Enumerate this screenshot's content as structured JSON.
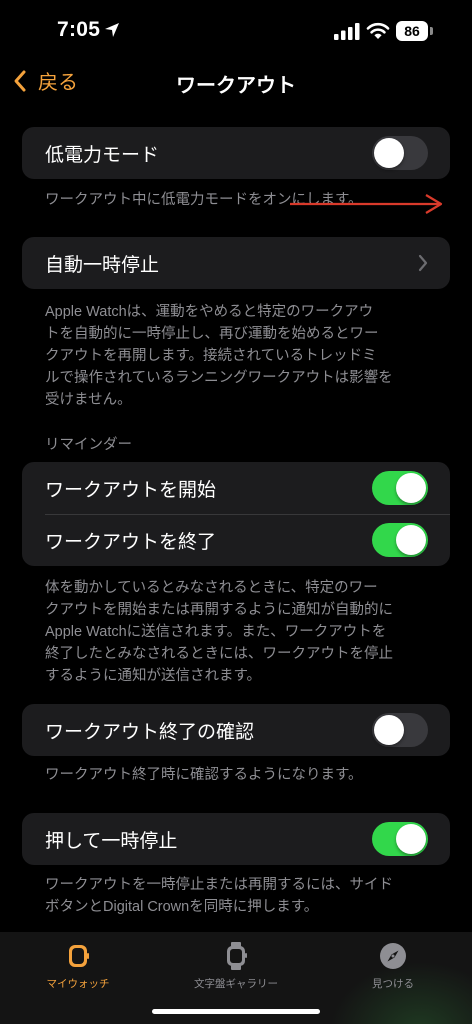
{
  "status": {
    "time": "7:05",
    "battery": "86"
  },
  "nav": {
    "back_label": "戻る",
    "title": "ワークアウト"
  },
  "low_power": {
    "label": "低電力モード",
    "toggle_on": false,
    "footer": "ワークアウト中に低電力モードをオンにします。"
  },
  "auto_pause": {
    "label": "自動一時停止",
    "footer_lines": [
      "Apple Watchは、運動をやめると特定のワークアウ",
      "トを自動的に一時停止し、再び運動を始めるとワー",
      "クアウトを再開します。接続されているトレッドミ",
      "ルで操作されているランニングワークアウトは影響を",
      "受けません。"
    ]
  },
  "reminders": {
    "header": "リマインダー",
    "items": [
      {
        "label": "ワークアウトを開始",
        "toggle_on": true
      },
      {
        "label": "ワークアウトを終了",
        "toggle_on": true
      }
    ],
    "footer_lines": [
      "体を動かしているとみなされるときに、特定のワー",
      "クアウトを開始または再開するように通知が自動的に",
      "Apple Watchに送信されます。また、ワークアウトを",
      "終了したとみなされるときには、ワークアウトを停止",
      "するように通知が送信されます。"
    ]
  },
  "confirm_end": {
    "label": "ワークアウト終了の確認",
    "toggle_on": false,
    "footer": "ワークアウト終了時に確認するようになります。"
  },
  "press_pause": {
    "label": "押して一時停止",
    "toggle_on": true,
    "footer_lines": [
      "ワークアウトを一時停止または再開するには、サイド",
      "ボタンとDigital Crownを同時に押します。"
    ]
  },
  "tabs": [
    {
      "label": "マイウォッチ",
      "icon": "watch-face-icon",
      "active": true
    },
    {
      "label": "文字盤ギャラリー",
      "icon": "watch-icon",
      "active": false
    },
    {
      "label": "見つける",
      "icon": "compass-icon",
      "active": false
    }
  ],
  "colors": {
    "accent": "#f4a23c",
    "toggle_on": "#32d74b",
    "annotation_arrow": "#d93a2b"
  }
}
